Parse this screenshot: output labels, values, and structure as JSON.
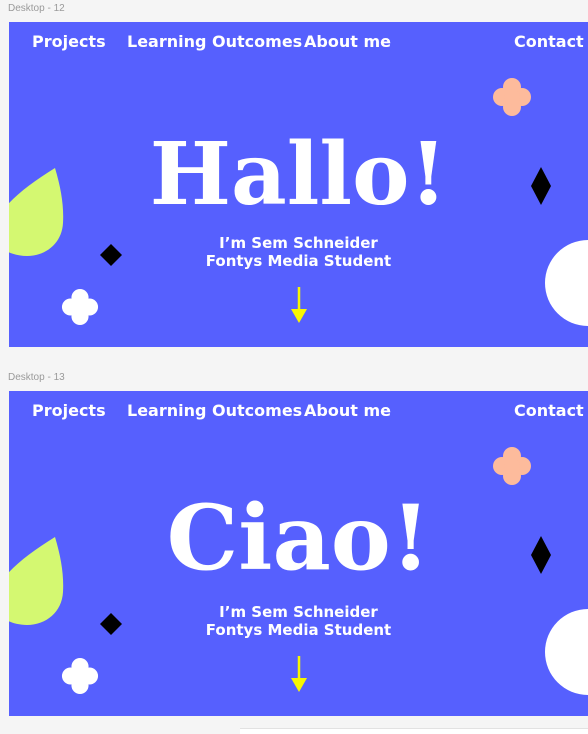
{
  "frames": [
    {
      "label": "Desktop - 12",
      "nav": {
        "projects": "Projects",
        "learning_outcomes": "Learning Outcomes",
        "about_me": "About me",
        "contact": "Contact"
      },
      "headline": "Hallo!",
      "intro_line1": "I’m Sem Schneider",
      "intro_line2": "Fontys Media Student"
    },
    {
      "label": "Desktop - 13",
      "nav": {
        "projects": "Projects",
        "learning_outcomes": "Learning Outcomes",
        "about_me": "About me",
        "contact": "Contact"
      },
      "headline": "Ciao!",
      "intro_line1": "I’m Sem Schneider",
      "intro_line2": "Fontys Media Student"
    }
  ],
  "colors": {
    "background": "#5660fe",
    "text": "#ffffff",
    "drop": "#d4f871",
    "flower_peach": "#fdbb9c",
    "flower_white": "#ffffff",
    "diamond": "#000000",
    "arrow": "#f8f600",
    "half_circle": "#ffffff"
  },
  "icons": [
    "flower-icon",
    "diamond-icon",
    "drop-shape-icon",
    "half-circle-icon",
    "arrow-down-icon"
  ]
}
